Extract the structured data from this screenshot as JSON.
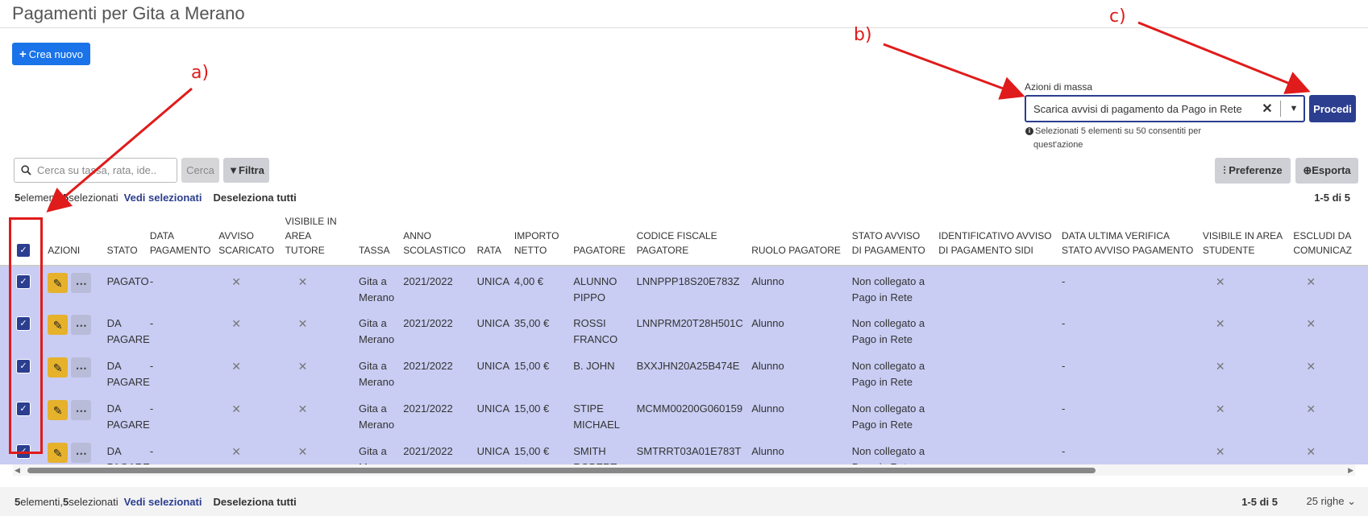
{
  "page": {
    "title": "Pagamenti per Gita a Merano"
  },
  "toolbar": {
    "create_label": "Crea nuovo"
  },
  "mass_actions": {
    "label": "Azioni di massa",
    "selected_value": "Scarica avvisi di pagamento da Pago in Rete",
    "submit_label": "Procedi",
    "note_line1": "Selezionati 5 elementi su 50 consentiti per",
    "note_line2": "quest'azione"
  },
  "search": {
    "placeholder": "Cerca su tassa, rata, ide..",
    "search_label": "Cerca",
    "filter_label": "Filtra"
  },
  "right_tools": {
    "preferences_label": "Preferenze",
    "export_label": "Esporta"
  },
  "selection": {
    "count": "5",
    "count_text": " elementi, ",
    "selected_count": "5",
    "selected_text": " selezionati",
    "view_selected": "Vedi selezionati",
    "deselect_all": "Deseleziona tutti",
    "pager": "1-5 di 5",
    "rows_per_page": "25 righe"
  },
  "table": {
    "columns": [
      "AZIONI",
      "STATO",
      "DATA PAGAMENTO",
      "AVVISO SCARICATO",
      "VISIBILE IN AREA TUTORE",
      "TASSA",
      "ANNO SCOLASTICO",
      "RATA",
      "IMPORTO NETTO",
      "PAGATORE",
      "CODICE FISCALE PAGATORE",
      "RUOLO PAGATORE",
      "STATO AVVISO DI PAGAMENTO",
      "IDENTIFICATIVO AVVISO DI PAGAMENTO SIDI",
      "DATA ULTIMA VERIFICA STATO AVVISO PAGAMENTO",
      "VISIBILE IN AREA STUDENTE",
      "ESCLUDI DA COMUNICAZ"
    ],
    "rows": [
      {
        "stato": "PAGATO",
        "data": "-",
        "tassa": "Gita a Merano",
        "anno": "2021/2022",
        "rata": "UNICA",
        "importo": "4,00 €",
        "pagatore": "ALUNNO PIPPO",
        "cf": "LNNPPP18S20E783Z",
        "ruolo": "Alunno",
        "stato_avviso": "Non collegato a Pago in Rete",
        "id_sidi": "",
        "data_verifica": "-"
      },
      {
        "stato": "DA PAGARE",
        "data": "-",
        "tassa": "Gita a Merano",
        "anno": "2021/2022",
        "rata": "UNICA",
        "importo": "35,00 €",
        "pagatore": "ROSSI FRANCO",
        "cf": "LNNPRM20T28H501C",
        "ruolo": "Alunno",
        "stato_avviso": "Non collegato a Pago in Rete",
        "id_sidi": "",
        "data_verifica": "-"
      },
      {
        "stato": "DA PAGARE",
        "data": "-",
        "tassa": "Gita a Merano",
        "anno": "2021/2022",
        "rata": "UNICA",
        "importo": "15,00 €",
        "pagatore": "B. JOHN",
        "cf": "BXXJHN20A25B474E",
        "ruolo": "Alunno",
        "stato_avviso": "Non collegato a Pago in Rete",
        "id_sidi": "",
        "data_verifica": "-"
      },
      {
        "stato": "DA PAGARE",
        "data": "-",
        "tassa": "Gita a Merano",
        "anno": "2021/2022",
        "rata": "UNICA",
        "importo": "15,00 €",
        "pagatore": "STIPE MICHAEL",
        "cf": "MCMM00200G060159",
        "ruolo": "Alunno",
        "stato_avviso": "Non collegato a Pago in Rete",
        "id_sidi": "",
        "data_verifica": "-"
      },
      {
        "stato": "DA PAGARE",
        "data": "-",
        "tassa": "Gita a Merano",
        "anno": "2021/2022",
        "rata": "UNICA",
        "importo": "15,00 €",
        "pagatore": "SMITH ROBERT",
        "cf": "SMTRRT03A01E783T",
        "ruolo": "Alunno",
        "stato_avviso": "Non collegato a Pago in Rete",
        "id_sidi": "",
        "data_verifica": "-"
      }
    ]
  },
  "annotations": {
    "a": "a)",
    "b": "b)",
    "c": "c)"
  },
  "colors": {
    "accent": "#2c3e8f",
    "primary": "#1a73e8",
    "row_selected": "#c9cdf3",
    "edit": "#e6b12b",
    "annotation": "#e01b1b"
  }
}
